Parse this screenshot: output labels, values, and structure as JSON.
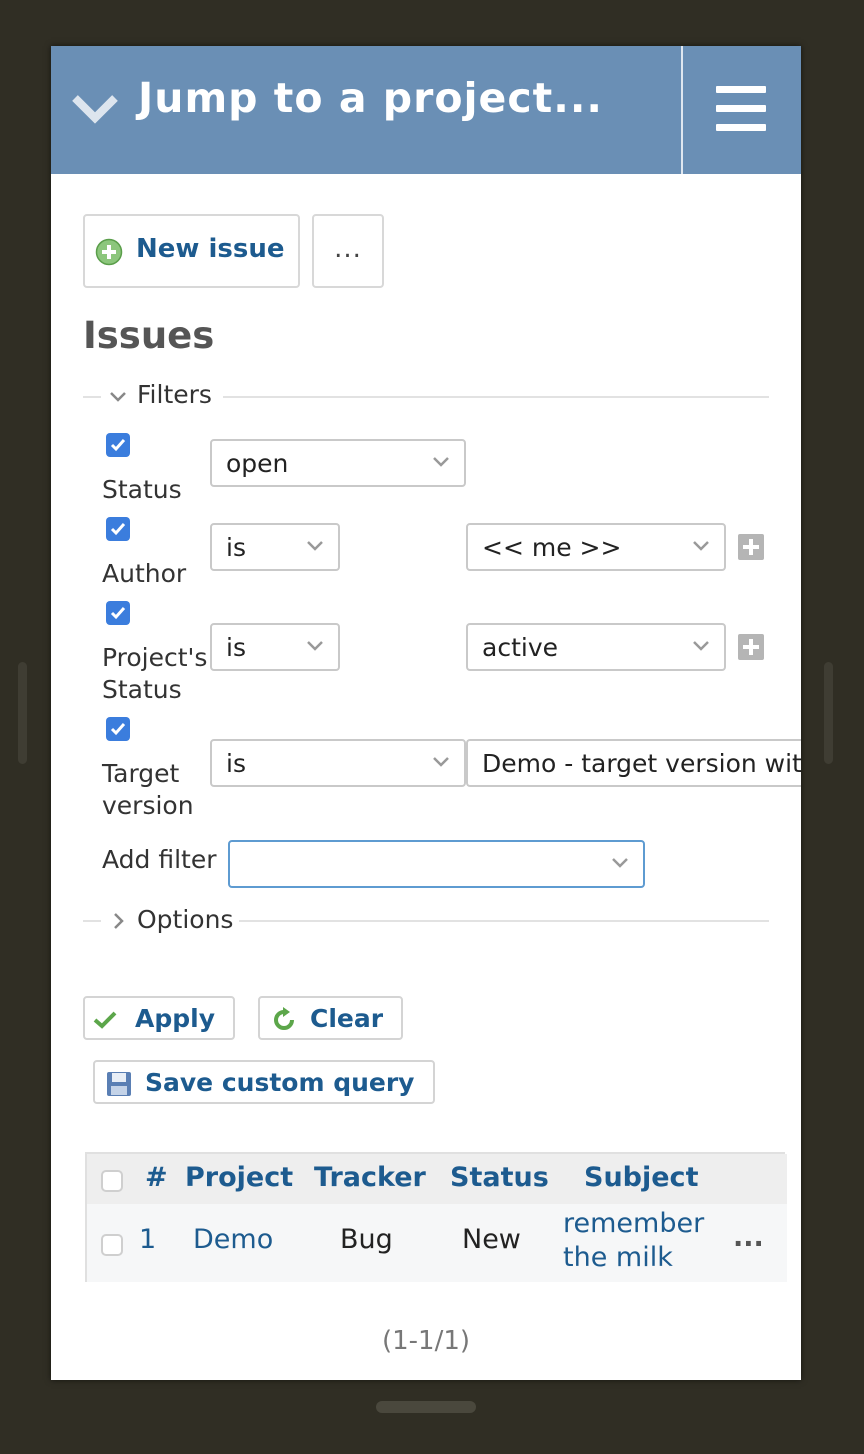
{
  "header": {
    "title": "Jump to a project...",
    "menu_icon": "hamburger-icon",
    "toggle_icon": "chevron-down-icon"
  },
  "toolbar": {
    "new_issue_label": "New issue",
    "more_label": "..."
  },
  "page_title": "Issues",
  "filters": {
    "legend": "Filters",
    "rows": [
      {
        "label": "Status",
        "checked": true,
        "operator": "open"
      },
      {
        "label": "Author",
        "checked": true,
        "operator": "is",
        "value": "<< me >>"
      },
      {
        "label_line1": "Project's",
        "label_line2": "Status",
        "checked": true,
        "operator": "is",
        "value": "active"
      },
      {
        "label_line1": "Target",
        "label_line2": "version",
        "checked": true,
        "operator": "is",
        "value": "Demo - target version with a long name"
      }
    ],
    "add_filter_label": "Add filter",
    "add_filter_value": ""
  },
  "options": {
    "legend": "Options"
  },
  "actions": {
    "apply": "Apply",
    "clear": "Clear",
    "save_query": "Save custom query"
  },
  "table": {
    "columns": [
      "#",
      "Project",
      "Tracker",
      "Status",
      "Subject"
    ],
    "rows": [
      {
        "id": "1",
        "project": "Demo",
        "tracker": "Bug",
        "status": "New",
        "subject_line1": "remember",
        "subject_line2": "the milk",
        "more": "..."
      }
    ]
  },
  "pagination": "(1-1/1)",
  "colors": {
    "header_bg": "#6a8fb5",
    "link": "#1d5b8f",
    "checkbox": "#3b7ddd"
  }
}
